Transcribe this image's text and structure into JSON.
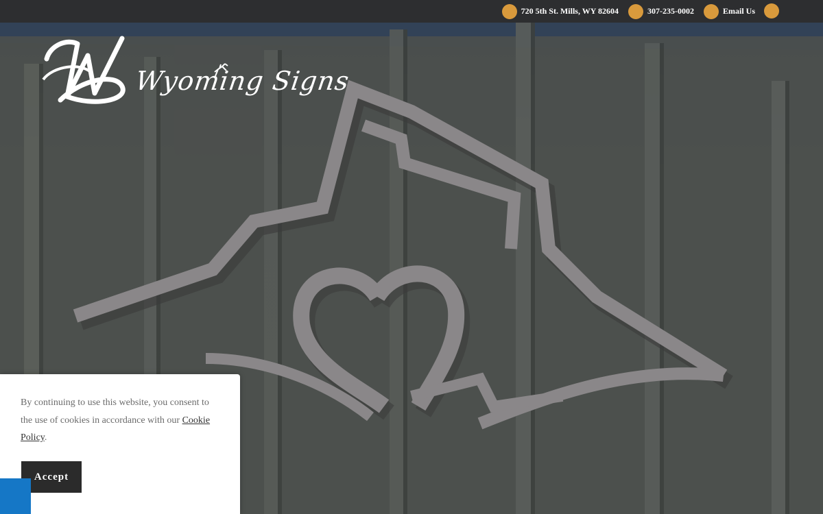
{
  "topbar": {
    "address": "720 5th St. Mills, WY 82604",
    "phone": "307-235-0002",
    "email_label": "Email Us",
    "icon_color": "#d99a3c",
    "icons": [
      "map-pin-icon",
      "phone-icon",
      "envelope-icon",
      "menu-icon"
    ]
  },
  "logo": {
    "brand_text": "Wyoming Signs",
    "monogram": "WS"
  },
  "cookie": {
    "text_before": "By continuing to use this website, you consent to the use of cookies in accordance with our ",
    "policy_link": "Cookie Policy",
    "text_after": ".",
    "accept_label": "Accept"
  },
  "accessibility": {
    "icon": "accessibility-icon",
    "color": "#1577c6"
  }
}
